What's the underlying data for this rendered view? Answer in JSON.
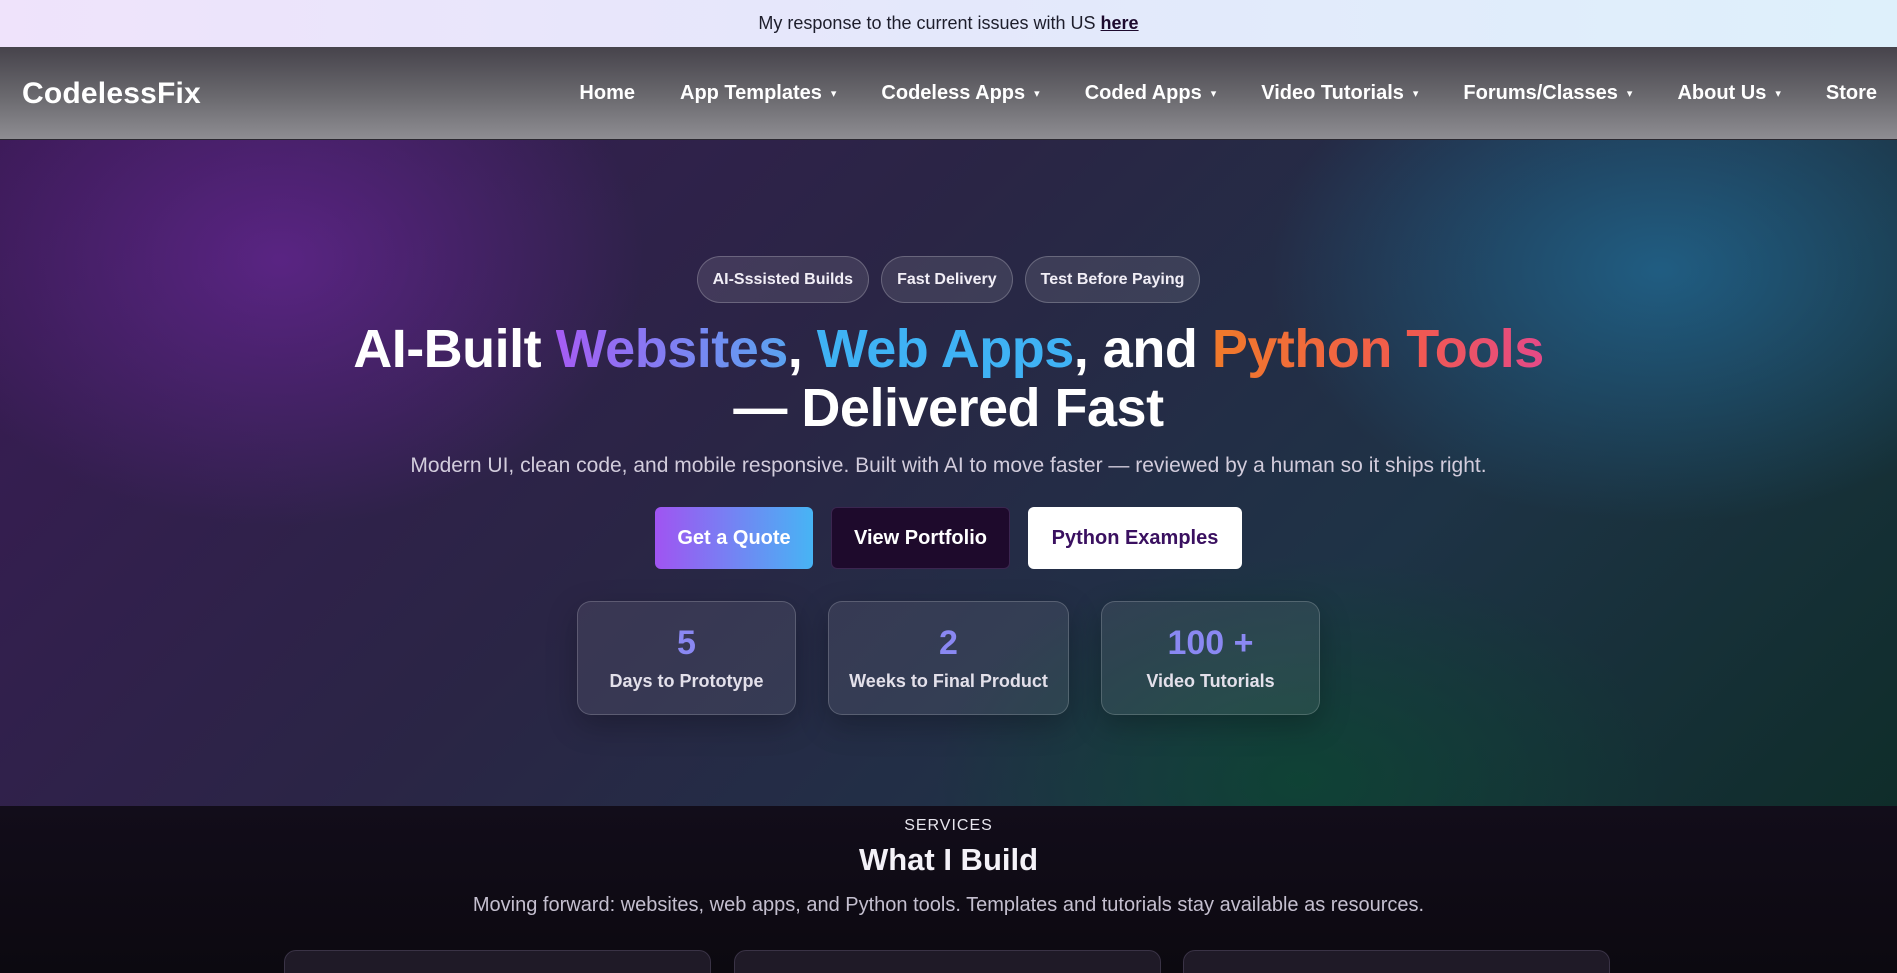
{
  "announcement": {
    "text": "My response to the current issues with US",
    "link": "here"
  },
  "nav": {
    "brand": "CodelessFix",
    "items": [
      {
        "label": "Home",
        "dropdown": false
      },
      {
        "label": "App Templates",
        "dropdown": true
      },
      {
        "label": "Codeless Apps",
        "dropdown": true
      },
      {
        "label": "Coded Apps",
        "dropdown": true
      },
      {
        "label": "Video Tutorials",
        "dropdown": true
      },
      {
        "label": "Forums/Classes",
        "dropdown": true
      },
      {
        "label": "About Us",
        "dropdown": true
      },
      {
        "label": "Store",
        "dropdown": false
      }
    ],
    "caret": "▾"
  },
  "hero": {
    "pills": [
      "AI-Sssisted Builds",
      "Fast Delivery",
      "Test Before Paying"
    ],
    "headline": {
      "part1": "AI-Built ",
      "websites": "Websites",
      "comma1": ", ",
      "webapps": "Web Apps",
      "and": ", and ",
      "python": "Python Tools",
      "line2": "— Delivered Fast"
    },
    "subtitle": "Modern UI, clean code, and mobile responsive. Built with AI to move faster — reviewed by a human so it ships right.",
    "buttons": {
      "quote": "Get a Quote",
      "portfolio": "View Portfolio",
      "python": "Python Examples"
    },
    "stats": [
      {
        "value": "5",
        "label": "Days to Prototype"
      },
      {
        "value": "2",
        "label": "Weeks to Final Product"
      },
      {
        "value": "100 +",
        "label": "Video Tutorials"
      }
    ]
  },
  "services": {
    "eyebrow": "SERVICES",
    "title": "What I Build",
    "subtitle": "Moving forward: websites, web apps, and Python tools. Templates and tutorials stay available as resources."
  },
  "colors": {
    "accent_purple": "#a054f2",
    "accent_blue": "#3fb2f4",
    "accent_orange": "#f07a2a",
    "accent_pink": "#e44a88",
    "stat_number": "#8a88f2"
  }
}
